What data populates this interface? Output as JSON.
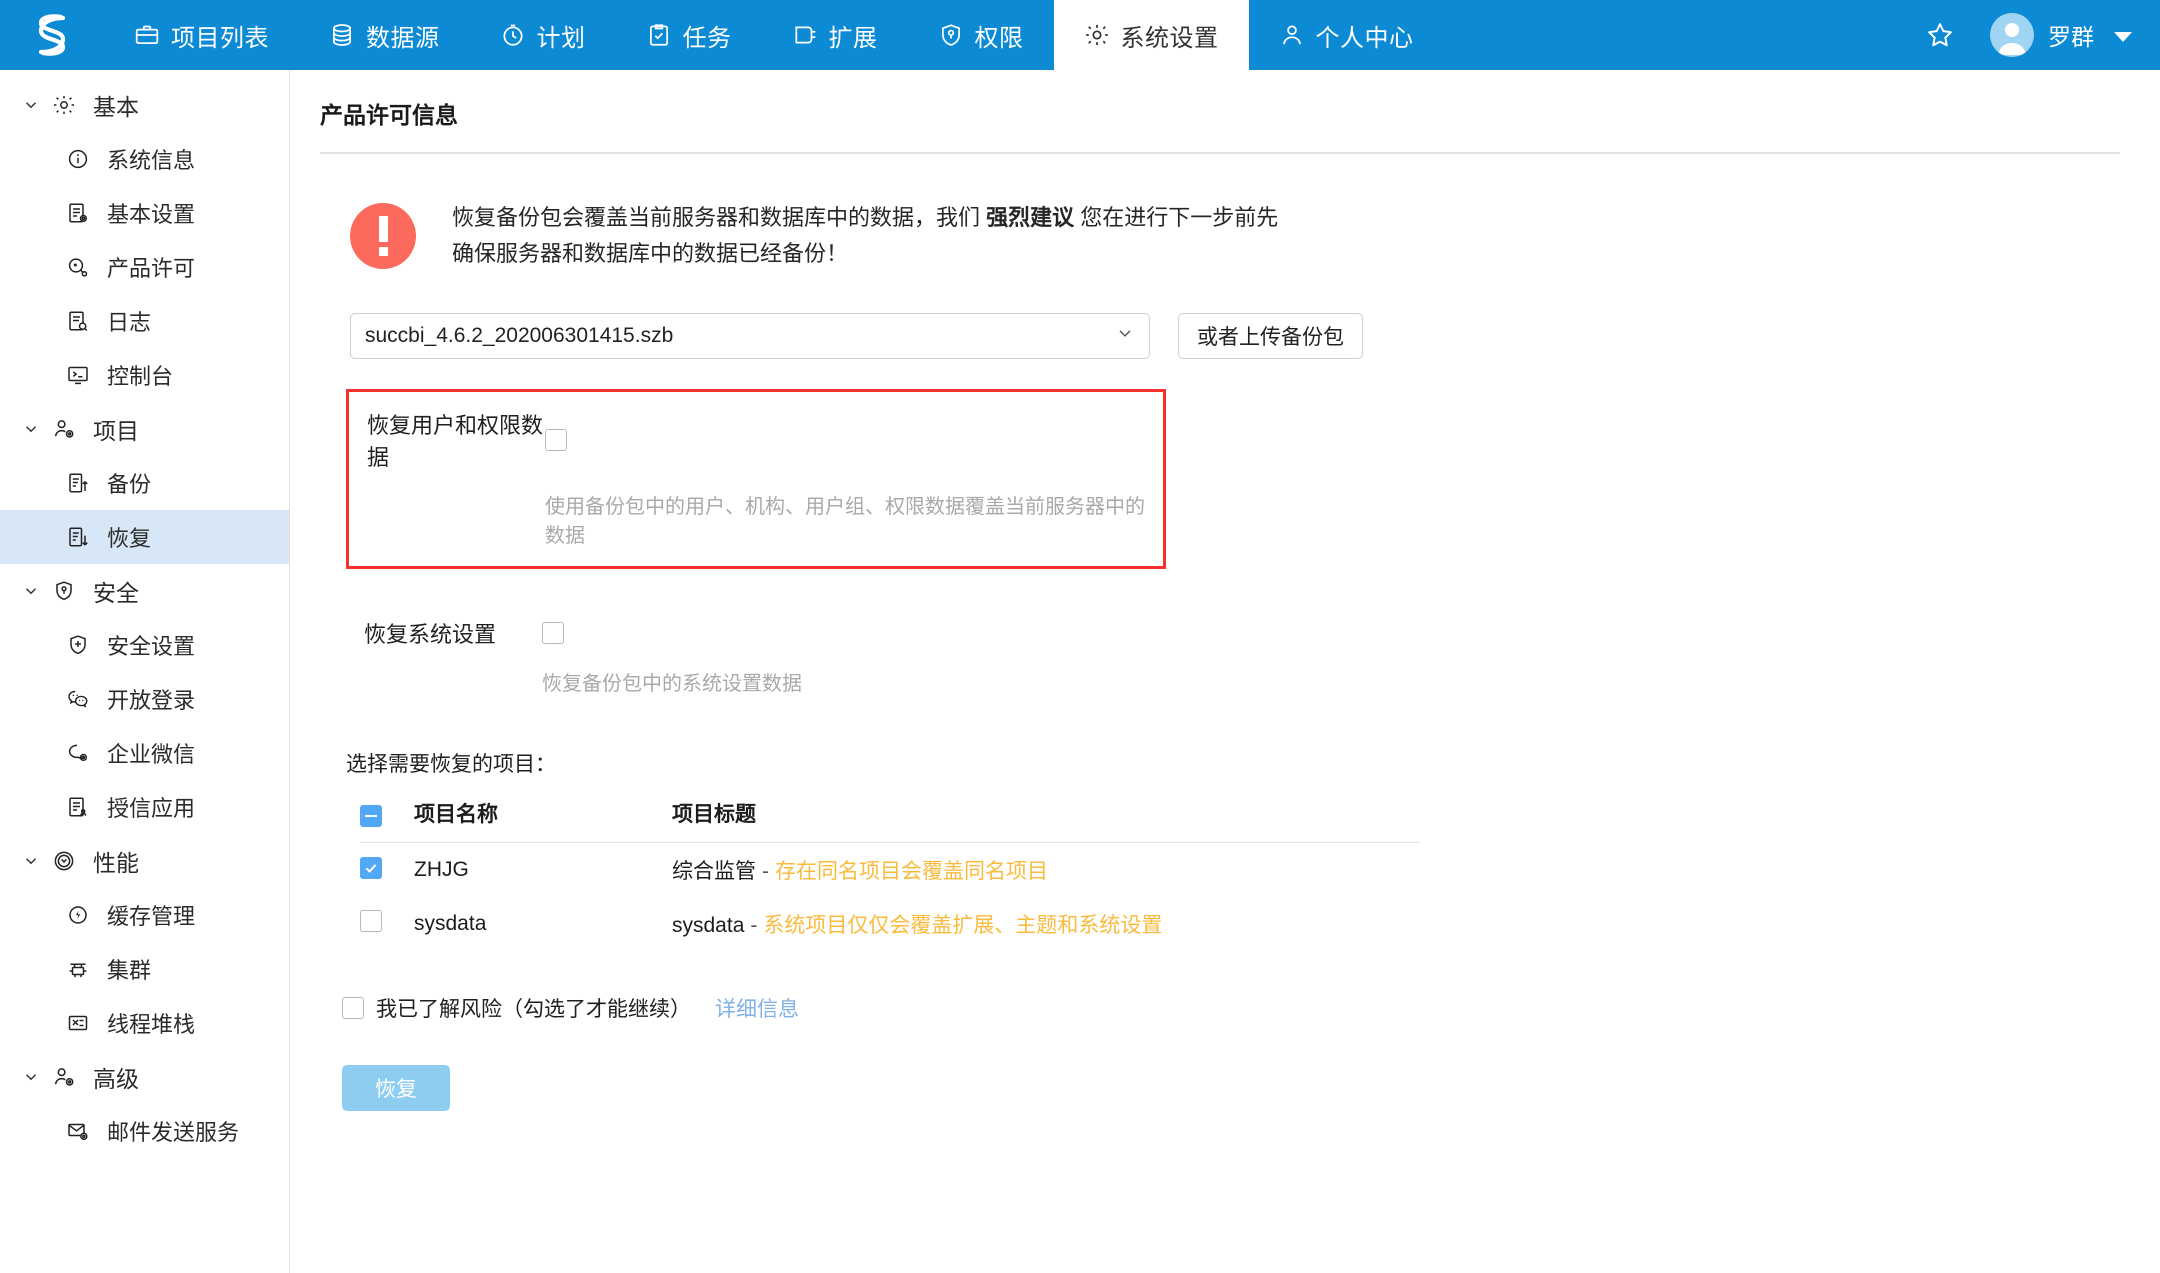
{
  "header": {
    "logo_name": "succbi-logo",
    "nav": [
      {
        "label": "项目列表",
        "icon": "briefcase-icon",
        "active": false
      },
      {
        "label": "数据源",
        "icon": "database-icon",
        "active": false
      },
      {
        "label": "计划",
        "icon": "clock-icon",
        "active": false
      },
      {
        "label": "任务",
        "icon": "clipboard-check-icon",
        "active": false
      },
      {
        "label": "扩展",
        "icon": "plugin-icon",
        "active": false
      },
      {
        "label": "权限",
        "icon": "shield-key-icon",
        "active": false
      },
      {
        "label": "系统设置",
        "icon": "gear-icon",
        "active": true
      },
      {
        "label": "个人中心",
        "icon": "user-icon",
        "active": false
      }
    ],
    "star_icon": "star-icon",
    "user": {
      "name": "罗群",
      "avatar_icon": "avatar-icon",
      "caret_icon": "chevron-down-icon"
    },
    "brand_color": "#0c8ad4"
  },
  "sidebar": {
    "groups": [
      {
        "label": "基本",
        "icon": "gear-icon",
        "chevron": "chevron-down-icon",
        "items": [
          {
            "label": "系统信息",
            "icon": "info-circle-icon",
            "active": false
          },
          {
            "label": "基本设置",
            "icon": "doc-gear-icon",
            "active": false
          },
          {
            "label": "产品许可",
            "icon": "license-key-icon",
            "active": false
          },
          {
            "label": "日志",
            "icon": "doc-search-icon",
            "active": false
          },
          {
            "label": "控制台",
            "icon": "console-icon",
            "active": false
          }
        ]
      },
      {
        "label": "项目",
        "icon": "user-gear-icon",
        "chevron": "chevron-down-icon",
        "items": [
          {
            "label": "备份",
            "icon": "doc-up-icon",
            "active": false
          },
          {
            "label": "恢复",
            "icon": "doc-down-icon",
            "active": true
          }
        ]
      },
      {
        "label": "安全",
        "icon": "shield-key-icon",
        "chevron": "chevron-down-icon",
        "items": [
          {
            "label": "安全设置",
            "icon": "shield-plus-icon",
            "active": false
          },
          {
            "label": "开放登录",
            "icon": "wechat-icon",
            "active": false
          },
          {
            "label": "企业微信",
            "icon": "chat-gear-icon",
            "active": false
          },
          {
            "label": "授信应用",
            "icon": "doc-user-icon",
            "active": false
          }
        ]
      },
      {
        "label": "性能",
        "icon": "gauge-icon",
        "chevron": "chevron-down-icon",
        "items": [
          {
            "label": "缓存管理",
            "icon": "cache-bolt-icon",
            "active": false
          },
          {
            "label": "集群",
            "icon": "cluster-icon",
            "active": false
          },
          {
            "label": "线程堆栈",
            "icon": "threads-icon",
            "active": false
          }
        ]
      },
      {
        "label": "高级",
        "icon": "user-gear-icon",
        "chevron": "chevron-down-icon",
        "items": [
          {
            "label": "邮件发送服务",
            "icon": "mail-gear-icon",
            "active": false
          }
        ]
      }
    ],
    "active_bg": "#d8e7f7"
  },
  "main": {
    "page_title": "产品许可信息",
    "alert": {
      "icon": "exclamation-circle-icon",
      "icon_color": "#fc6a5d",
      "text_part1": "恢复备份包会覆盖当前服务器和数据库中的数据，我们 ",
      "text_strong": "强烈建议",
      "text_part2": " 您在进行下一步前先确保服务器和数据库中的数据已经备份！"
    },
    "file_select": {
      "value": "succbi_4.6.2_202006301415.szb",
      "caret_icon": "chevron-down-icon"
    },
    "upload_button": "或者上传备份包",
    "options": [
      {
        "label": "恢复用户和权限数据",
        "checked": false,
        "desc": "使用备份包中的用户、机构、用户组、权限数据覆盖当前服务器中的数据",
        "highlighted": true,
        "highlight_color": "#f5312d"
      },
      {
        "label": "恢复系统设置",
        "checked": false,
        "desc": "恢复备份包中的系统设置数据",
        "highlighted": false
      }
    ],
    "table": {
      "caption": "选择需要恢复的项目：",
      "header_checkbox_state": "indeterminate",
      "columns": [
        "项目名称",
        "项目标题"
      ],
      "rows": [
        {
          "checked": true,
          "name": "ZHJG",
          "title": "综合监管",
          "dash": "-",
          "note": "存在同名项目会覆盖同名项目"
        },
        {
          "checked": false,
          "name": "sysdata",
          "title": "sysdata",
          "dash": "-",
          "note": "系统项目仅仅会覆盖扩展、主题和系统设置"
        }
      ],
      "note_color": "#fabb3d",
      "checkbox_color": "#52a8f5"
    },
    "acknowledge": {
      "checked": false,
      "label": "我已了解风险（勾选了才能继续）",
      "link": "详细信息"
    },
    "restore_button": {
      "label": "恢复",
      "enabled": false,
      "color": "#8fcdf0"
    }
  }
}
